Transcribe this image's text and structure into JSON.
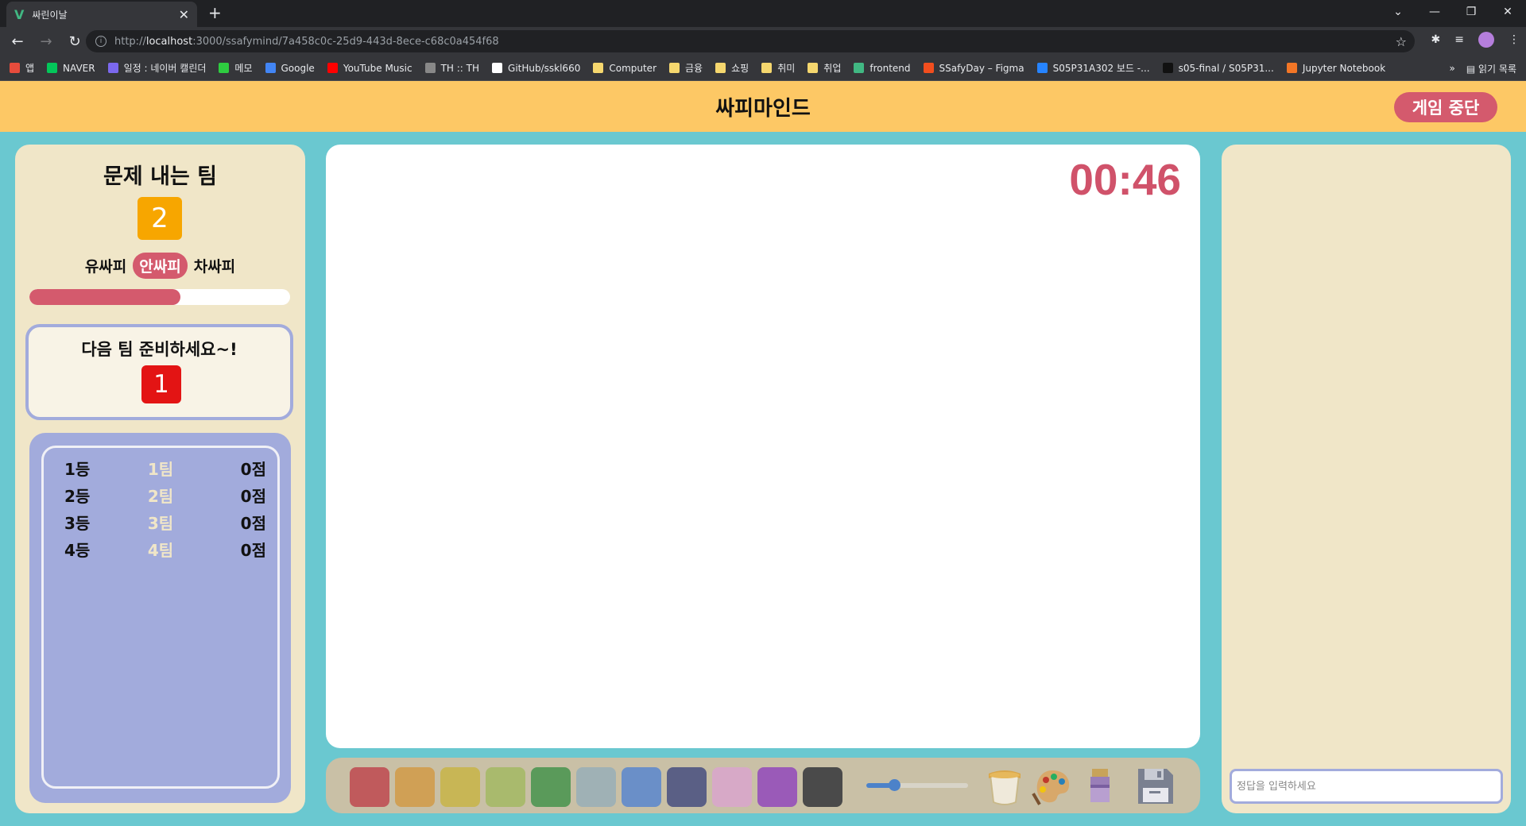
{
  "browser": {
    "tab_title": "싸린이날",
    "tab_favicon": "V",
    "url_prefix": "http://",
    "url_host": "localhost",
    "url_rest": ":3000/ssafymind/7a458c0c-25d9-443d-8ece-c68c0a454f68",
    "bookmarks": [
      {
        "label": "앱",
        "color": "#e74c3c"
      },
      {
        "label": "NAVER",
        "color": "#03c75a"
      },
      {
        "label": "일정 : 네이버 캘린더",
        "color": "#7b68ee"
      },
      {
        "label": "메모",
        "color": "#2ecc40"
      },
      {
        "label": "Google",
        "color": "#4285f4"
      },
      {
        "label": "YouTube Music",
        "color": "#ff0000"
      },
      {
        "label": "TH :: TH",
        "color": "#888888"
      },
      {
        "label": "GitHub/sskl660",
        "color": "#ffffff"
      },
      {
        "label": "Computer",
        "color": "#f5d76e"
      },
      {
        "label": "금융",
        "color": "#f5d76e"
      },
      {
        "label": "쇼핑",
        "color": "#f5d76e"
      },
      {
        "label": "취미",
        "color": "#f5d76e"
      },
      {
        "label": "취업",
        "color": "#f5d76e"
      },
      {
        "label": "frontend",
        "color": "#41b883"
      },
      {
        "label": "SSafyDay – Figma",
        "color": "#f24e1e"
      },
      {
        "label": "S05P31A302 보드 -...",
        "color": "#2684ff"
      },
      {
        "label": "s05-final / S05P31...",
        "color": "#111111"
      },
      {
        "label": "Jupyter Notebook",
        "color": "#f37626"
      }
    ],
    "bookmarks_more": "»",
    "reading_list": "읽기 목록"
  },
  "app": {
    "title": "싸피마인드",
    "stop_button": "게임 중단",
    "left": {
      "section_title": "문제 내는 팀",
      "current_team": "2",
      "phases": [
        {
          "label": "유싸피",
          "active": false
        },
        {
          "label": "안싸피",
          "active": true
        },
        {
          "label": "차싸피",
          "active": false
        }
      ],
      "progress": 0.58,
      "next_text": "다음 팀 준비하세요~!",
      "next_team": "1",
      "rankings": [
        {
          "rank": "1등",
          "team": "1팀",
          "score": "0점"
        },
        {
          "rank": "2등",
          "team": "2팀",
          "score": "0점"
        },
        {
          "rank": "3등",
          "team": "3팀",
          "score": "0점"
        },
        {
          "rank": "4등",
          "team": "4팀",
          "score": "0점"
        }
      ]
    },
    "timer": "00:46",
    "palette": {
      "colors": [
        "#c05a5c",
        "#d0a055",
        "#c8b655",
        "#a9ba6d",
        "#5a9a5a",
        "#9fb1b5",
        "#6a8fc8",
        "#5a5f85",
        "#d7a9c7",
        "#9a5ab8",
        "#4a4a4a"
      ],
      "brush_size": 0.28,
      "tools": [
        "paint-bucket-icon",
        "palette-icon",
        "eraser-icon",
        "save-icon"
      ]
    },
    "answer_placeholder": "정답을 입력하세요"
  }
}
